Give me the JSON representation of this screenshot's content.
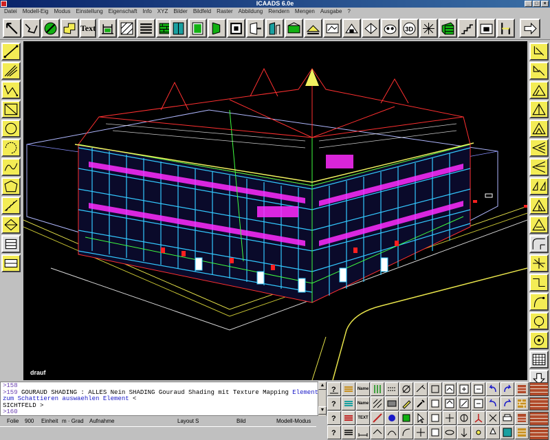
{
  "window": {
    "title": "ICAADS 6.0e",
    "controls": [
      "minimize",
      "maximize",
      "close"
    ]
  },
  "menu": [
    "Datei",
    "Modell-Eig",
    "Modus",
    "Einstellung",
    "Eigenschaft",
    "Info",
    "XYZ",
    "Bilder",
    "Bildfeld",
    "Raster",
    "Abbildung",
    "Rendern",
    "Mengen",
    "Ausgabe",
    "?"
  ],
  "toolbar": {
    "text_label": "Text",
    "icons": [
      "pointer-icon",
      "line-icon",
      "circle-icon",
      "polyline-icon",
      "text-icon",
      "dimension-icon",
      "hatch-icon",
      "stairs-icon",
      "wall-icon",
      "door-icon",
      "window-icon",
      "opening-icon",
      "column-icon",
      "beam-icon",
      "roof-icon",
      "floor-icon",
      "room-icon",
      "terrain-icon",
      "landscape-icon",
      "perspective-icon",
      "3d-icon",
      "plan-icon",
      "grid-icon",
      "stair-3d-icon",
      "section-icon",
      "chair-icon",
      "arrow-right-icon"
    ],
    "colors": {
      "green": "#12b012",
      "teal": "#1aa0a0",
      "blue": "#3a60c8"
    }
  },
  "left_palette": [
    "line-tool-icon",
    "multiline-icon",
    "polyline-tool-icon",
    "rectangle-tool-icon",
    "circle-tool-icon",
    "arc-tool-icon",
    "spline-icon",
    "polygon-icon",
    "stair-tool-icon",
    "diamond-icon",
    "grid-tool-icon",
    "frame-icon"
  ],
  "right_palette": [
    "copy-icon",
    "move-icon",
    "rotate-icon",
    "mirror-icon",
    "offset-icon",
    "scale-icon",
    "stretch-icon",
    "array-icon",
    "trim-icon",
    "extend-icon",
    "fillet-icon",
    "chamfer-icon",
    "break-icon",
    "join-icon",
    "erase-icon",
    "undo-icon",
    "grid-icon",
    "arrow-down-icon"
  ],
  "viewport": {
    "label": "drauf",
    "background": "#000000"
  },
  "console": {
    "lines": [
      {
        "prompt": ">158",
        "text": ""
      },
      {
        "prompt": ">159",
        "text": "GOURAUD SHADING : ALLES Nein SHADING Gouraud Shading mit Texture Mapping",
        "highlight": "Elemente"
      },
      {
        "prompt": "",
        "text": "",
        "highlight": "zum Schattieren auswaehlen  Element",
        "tail": " <"
      },
      {
        "prompt": "",
        "text": " SICHTFELD  >"
      },
      {
        "prompt": ">160",
        "text": ""
      }
    ]
  },
  "statusbar": {
    "folie_label": "Folie",
    "folie_value": "900",
    "einheit_label": "Einheit",
    "einheit_value": "m · Grad",
    "aufnahme": "Aufnahme",
    "layout_label": "Layout",
    "layout_value": "S",
    "bild": "Bild",
    "modus": "Modell-Modus"
  },
  "bottom_palette": {
    "label_name": "Name",
    "label_text": "TEXT",
    "rows": 4,
    "cols": 14
  }
}
